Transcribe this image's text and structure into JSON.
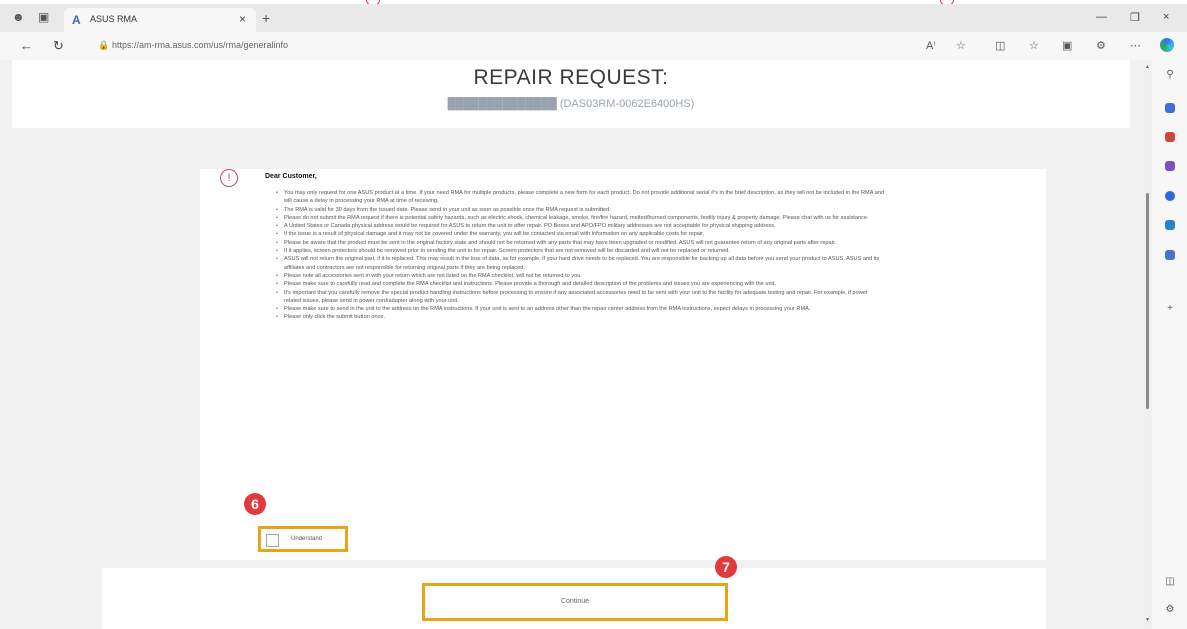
{
  "browser": {
    "tab_title": "ASUS RMA",
    "new_tab": "+",
    "url": "https://am-rma.asus.com/us/rma/generalinfo"
  },
  "page": {
    "title": "REPAIR REQUEST:",
    "subtitle": "██████████████ (DAS03RM-0062E6400HS)",
    "greeting": "Dear Customer,",
    "notices": [
      "You may only request for one ASUS product at a time. If your need RMA for multiple products, please complete a new form for each product. Do not provide additional serial #'s in the brief description, as they will not be included in the RMA and will cause a delay in processing your RMA at time of receiving.",
      "The RMA is valid for 30 days from the issued date. Please send in your unit as soon as possible once the RMA request is submitted.",
      "Please do not submit the RMA request if there is potential safety hazards, such as electric shock, chemical leakage, smoke, fire/fire hazard, melted/burned components, bodily injury & property damage. Please chat with us for assistance.",
      "A United States or Canada physical address would be required for ASUS to return the unit to after repair. PO Boxes and APO/FPO military addresses are not acceptable for physical shipping address.",
      "If the issue is a result of physical damage and it may not be covered under the warranty, you will be contacted via email with information on any applicable costs for repair.",
      "Please be aware that the product must be sent in the original factory state and should not be returned with any parts that may have been upgraded or modified. ASUS will not guarantee return of any original parts after repair.",
      "If it applies, screen protectors should be removed prior to sending the unit in for repair. Screen protectors that are not removed will be discarded and will not be replaced or returned.",
      "ASUS will not return the original part, if it is replaced. This may result in the loss of data, as for example, if your hard drive needs to be replaced. You are responsible for backing up all data before you send your product to ASUS. ASUS and its affiliates and contractors are not responsible for returning original parts if they are being replaced.",
      "Please note all accessories sent in with your return which are not listed on the RMA checklist, will not be returned to you.",
      "Please make sure to carefully read and complete the RMA checklist and instructions. Please provide a thorough and detailed description of the problems and issues you are experiencing with the unit.",
      "It's important that you carefully remove the special product handling instructions before processing to ensure if any associated accessories need to be sent with your unit to the facility for adequate testing and repair. For example, if power related issues, please send in power cord/adapter along with your unit.",
      "Please make sure to send in the unit to the address on the RMA instructions. If your unit is sent to an address other than the repair center address from the RMA instructions, expect delays in processing your RMA.",
      "Please only click the submit button once."
    ],
    "agree_label": "Understand",
    "continue_label": "Continue"
  },
  "badges": {
    "step6": "6",
    "step7": "7"
  },
  "colors": {
    "highlight": "#e8a317",
    "badge": "#e0393e",
    "warning": "#c24a73",
    "link": "#4a90c8"
  }
}
